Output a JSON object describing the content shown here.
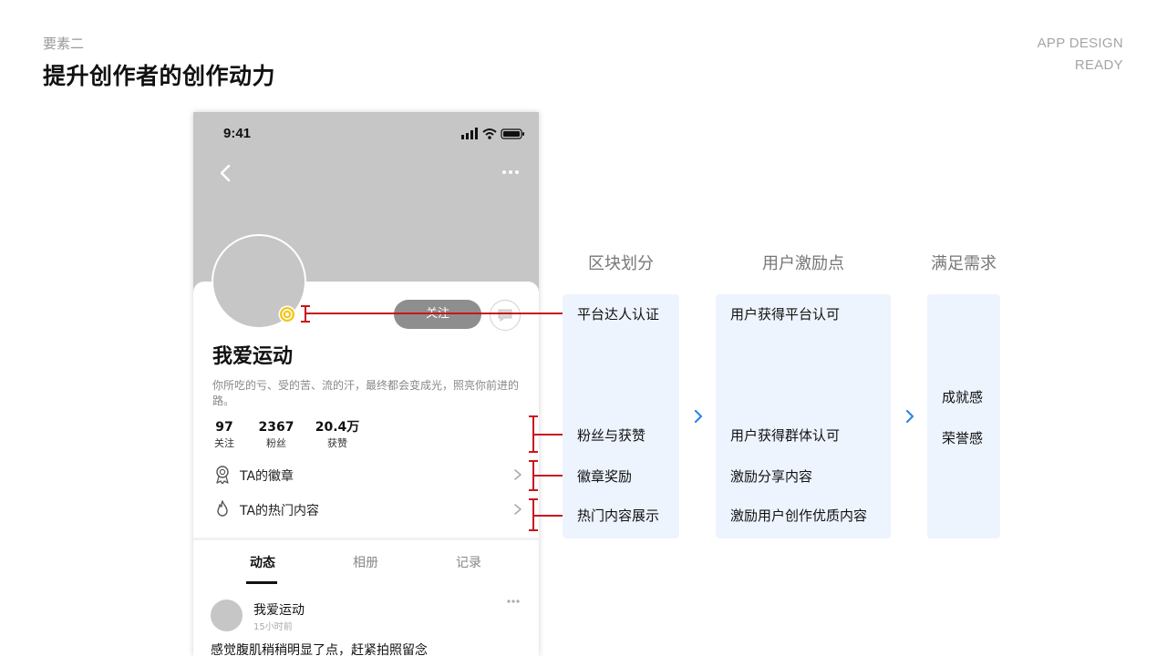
{
  "header": {
    "section_label": "要素二",
    "title": "提升创作者的创作动力",
    "brand_line1": "APP DESIGN",
    "brand_line2": "READY"
  },
  "phone": {
    "status_time": "9:41",
    "follow_label": "关注",
    "username": "我爱运动",
    "bio": "你所吃的亏、受的苦、流的汗，最终都会变成光，照亮你前进的路。",
    "stats": [
      {
        "value": "97",
        "label": "关注"
      },
      {
        "value": "2367",
        "label": "粉丝"
      },
      {
        "value": "20.4万",
        "label": "获赞"
      }
    ],
    "entries": [
      {
        "label": "TA的徽章",
        "icon": "medal-icon"
      },
      {
        "label": "TA的热门内容",
        "icon": "flame-icon"
      }
    ],
    "tabs": [
      "动态",
      "相册",
      "记录"
    ],
    "active_tab": "动态",
    "post": {
      "user": "我爱运动",
      "time": "15小时前",
      "text": "感觉腹肌稍稍明显了点，赶紧拍照留念"
    }
  },
  "analysis": {
    "columns": [
      {
        "title": "区块划分",
        "items": [
          "平台达人认证",
          "粉丝与获赞",
          "徽章奖励",
          "热门内容展示"
        ]
      },
      {
        "title": "用户激励点",
        "items": [
          "用户获得平台认可",
          "用户获得群体认可",
          "激励分享内容",
          "激励用户创作优质内容"
        ]
      },
      {
        "title": "满足需求",
        "items": [
          "成就感",
          "荣誉感"
        ]
      }
    ]
  },
  "colors": {
    "accent_red": "#c8161d",
    "arrow_blue": "#2f86e6",
    "box_bg": "#edf4fd",
    "placeholder_gray": "#c6c6c6"
  }
}
